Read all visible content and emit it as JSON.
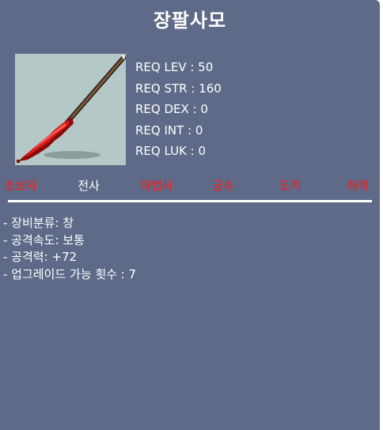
{
  "item": {
    "name": "장팔사모",
    "icon": "spear-icon",
    "requirements": [
      {
        "label": "REQ LEV",
        "value": "50"
      },
      {
        "label": "REQ STR",
        "value": "160"
      },
      {
        "label": "REQ DEX",
        "value": "0"
      },
      {
        "label": "REQ INT",
        "value": "0"
      },
      {
        "label": "REQ LUK",
        "value": "0"
      }
    ],
    "jobs": [
      {
        "label": "초보자",
        "enabled": false
      },
      {
        "label": "전사",
        "enabled": true
      },
      {
        "label": "마법사",
        "enabled": false
      },
      {
        "label": "궁수",
        "enabled": false
      },
      {
        "label": "도적",
        "enabled": false
      },
      {
        "label": "해적",
        "enabled": false
      }
    ],
    "stats": [
      "- 장비분류: 창",
      "- 공격속도: 보통",
      "- 공격력: +72",
      "- 업그레이드 가능 횟수 : 7"
    ]
  },
  "colors": {
    "panel": "#5e6a88",
    "job_enabled": "#ffffff",
    "job_disabled": "#ff1a1a",
    "icon_background": "#b4c8c8",
    "spear_blade": "#d81a1a",
    "spear_shaft": "#5a3a22"
  }
}
